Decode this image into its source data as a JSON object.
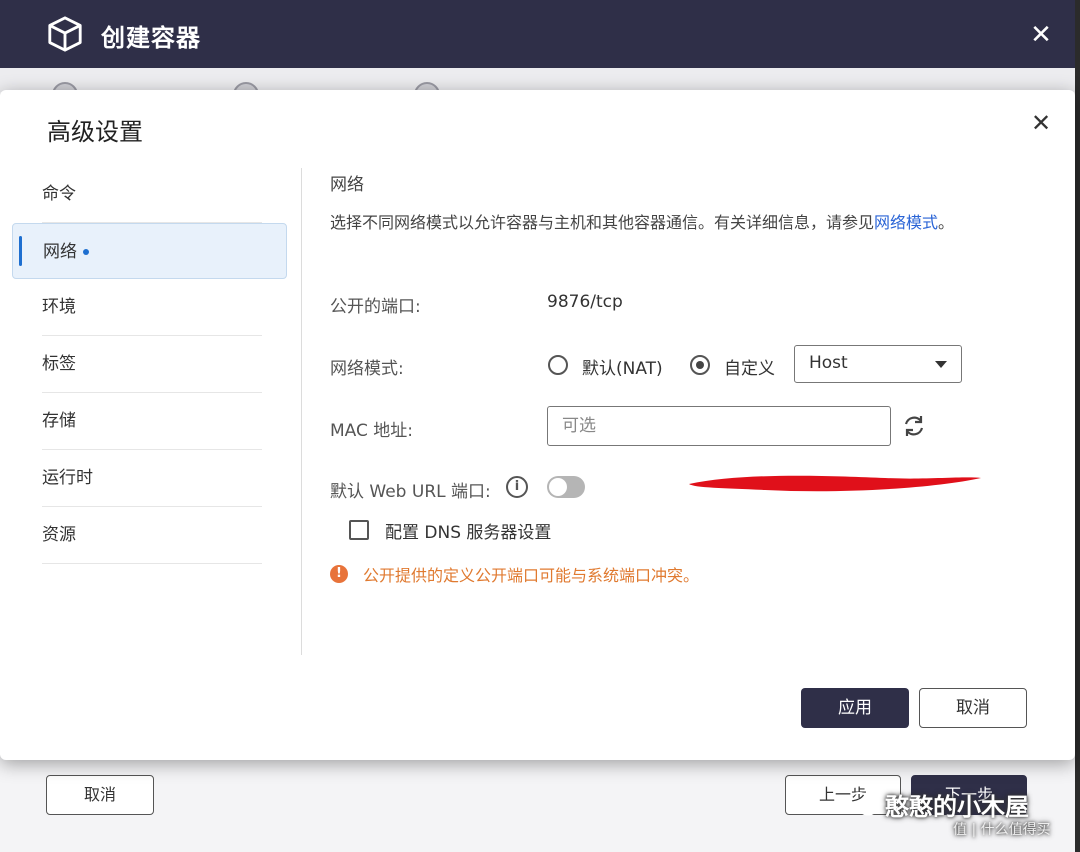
{
  "window": {
    "title": "创建容器",
    "close_glyph": "✕",
    "cube_icon": "cube-icon"
  },
  "outer_footer": {
    "cancel_label": "取消",
    "prev_label": "上一步",
    "next_label": "下一步"
  },
  "modal": {
    "title": "高级设置",
    "close_glyph": "✕",
    "sidebar": [
      {
        "label": "命令",
        "active": false
      },
      {
        "label": "网络",
        "active": true
      },
      {
        "label": "环境",
        "active": false
      },
      {
        "label": "标签",
        "active": false
      },
      {
        "label": "存储",
        "active": false
      },
      {
        "label": "运行时",
        "active": false
      },
      {
        "label": "资源",
        "active": false
      }
    ],
    "network": {
      "section_title": "网络",
      "description": "选择不同网络模式以允许容器与主机和其他容器通信。有关详细信息，请参见",
      "description_link": "网络模式",
      "description_end": "。",
      "public_port_label": "公开的端口:",
      "public_port_value": "9876/tcp",
      "mode_label": "网络模式:",
      "mode_default_label": "默认(NAT)",
      "mode_custom_label": "自定义",
      "mode_selected": "custom",
      "mode_select_value": "Host",
      "mac_label": "MAC 地址:",
      "mac_placeholder": "可选",
      "mac_value": "",
      "web_url_label": "默认 Web URL 端口:",
      "web_url_enabled": false,
      "dns_label": "配置 DNS 服务器设置",
      "dns_checked": false,
      "warning_text": "公开提供的定义公开端口可能与系统端口冲突。"
    },
    "apply_label": "应用",
    "cancel_label": "取消"
  },
  "colors": {
    "header_bg": "#2f2f48",
    "accent": "#1e6fd0",
    "warning": "#e07a30",
    "annotation_red": "#e0101a"
  },
  "watermark": {
    "main": "憨憨的小木屋",
    "sub": "值 | 什么值得买"
  }
}
